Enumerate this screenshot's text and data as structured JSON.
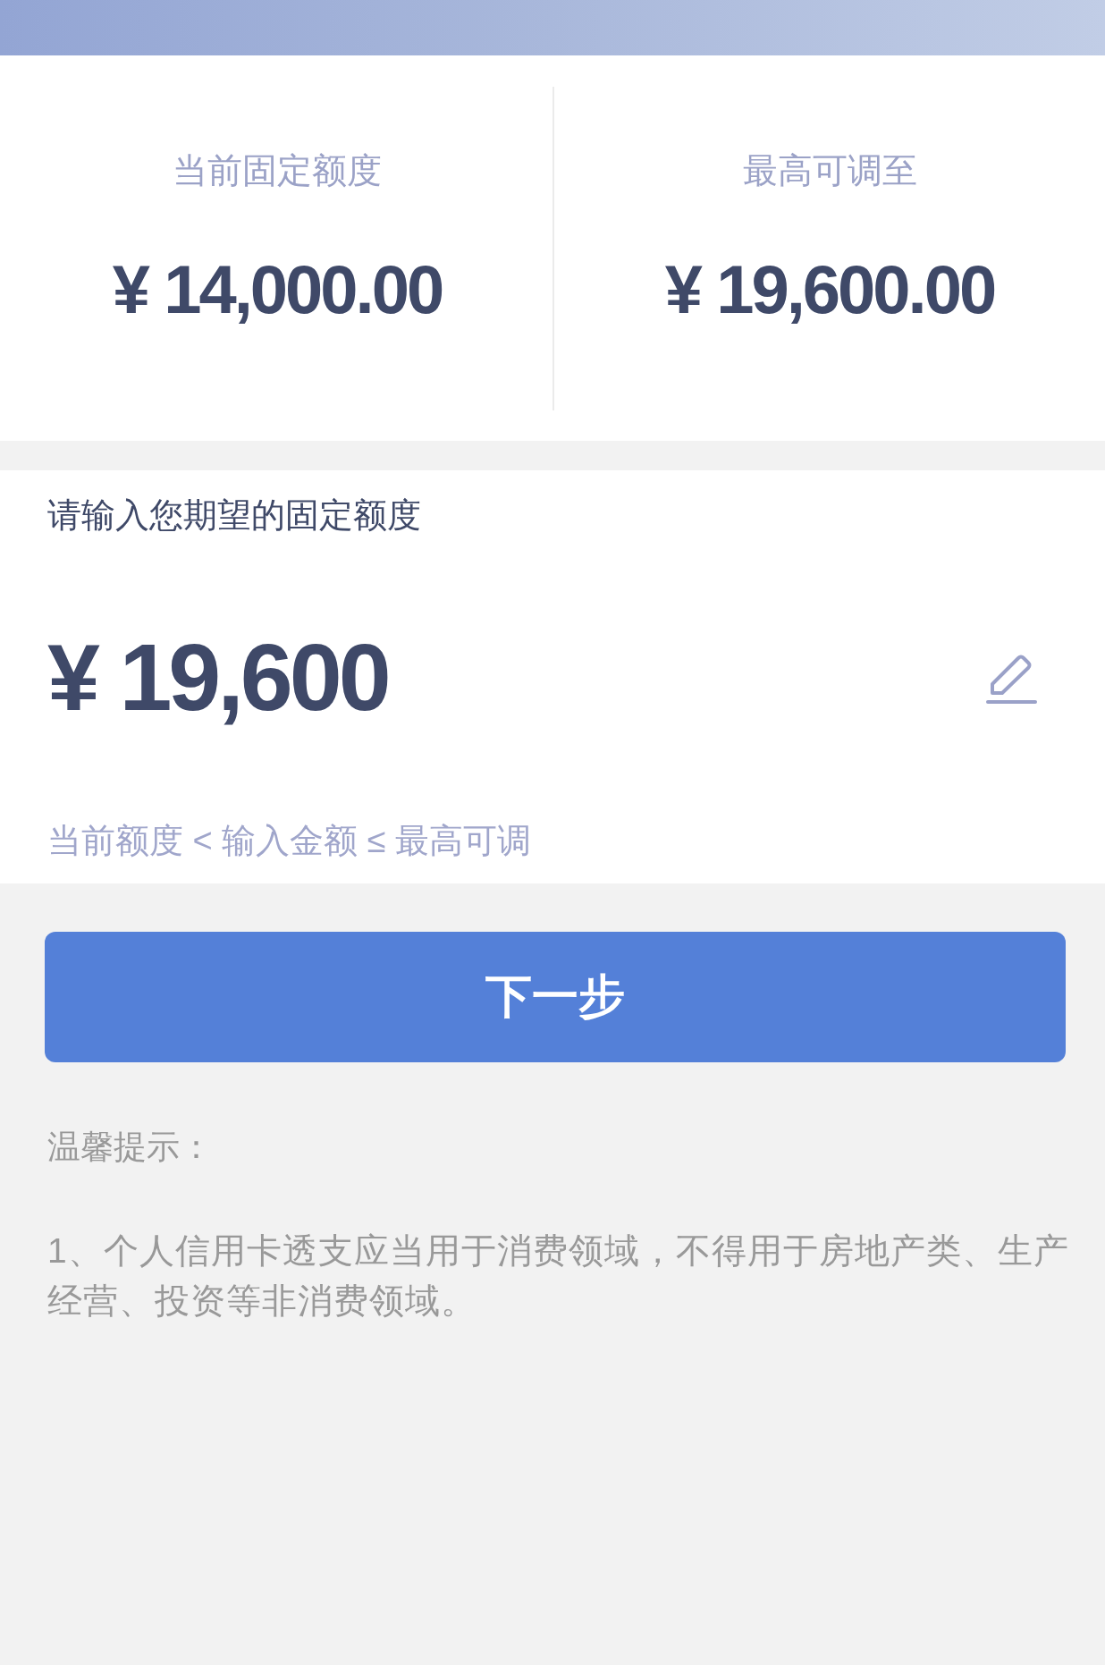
{
  "limits": [
    {
      "label": "当前固定额度",
      "amount": "¥ 14,000.00"
    },
    {
      "label": "最高可调至",
      "amount": "¥ 19,600.00"
    }
  ],
  "amount_field": {
    "label": "请输入您期望的固定额度",
    "value": "¥ 19,600",
    "range_note": "当前额度 < 输入金额 ≤ 最高可调"
  },
  "next_button": {
    "label": "下一步"
  },
  "tips": {
    "title": "温馨提示：",
    "items": [
      "1、个人信用卡透支应当用于消费领域，不得用于房地产类、生产经营、投资等非消费领域。"
    ]
  }
}
